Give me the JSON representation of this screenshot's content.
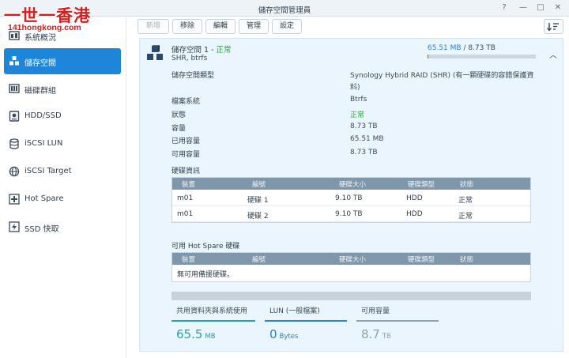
{
  "watermark": {
    "top": "一世一香港",
    "bottom": "141hongkong.com"
  },
  "window": {
    "title": "儲存空間管理員",
    "help_icon": "?",
    "minimize_icon": "—",
    "maximize_icon": "□",
    "close_icon": "✕"
  },
  "sidebar": {
    "items": [
      {
        "label": "系統概況",
        "icon": "overview-icon"
      },
      {
        "label": "儲存空間",
        "icon": "storage-cubes-icon",
        "active": true
      },
      {
        "label": "磁碟群組",
        "icon": "disk-group-icon"
      },
      {
        "label": "HDD/SSD",
        "icon": "hdd-icon"
      },
      {
        "label": "iSCSI LUN",
        "icon": "lun-icon"
      },
      {
        "label": "iSCSI Target",
        "icon": "target-icon"
      },
      {
        "label": "Hot Spare",
        "icon": "plus-icon"
      },
      {
        "label": "SSD 快取",
        "icon": "ssd-icon"
      }
    ]
  },
  "toolbar": {
    "create": "新增",
    "remove": "移除",
    "edit": "編輯",
    "manage": "管理",
    "settings": "設定",
    "sort_icon": "sort-icon"
  },
  "volume": {
    "name": "儲存空間 1",
    "separator": " - ",
    "status": "正常",
    "subtitle": "SHR, btrfs",
    "usage_used": "65.51 MB",
    "usage_sep": " / ",
    "usage_total": "8.73 TB",
    "usage_fraction": 1e-05,
    "properties": [
      {
        "label": "儲存空間類型",
        "value": "Synology Hybrid RAID (SHR) (有一顆硬碟的容錯保護資",
        "value2": "料)"
      },
      {
        "label": "檔案系統",
        "value": "Btrfs"
      },
      {
        "label": "狀態",
        "value": "正常",
        "status": true
      },
      {
        "label": "容量",
        "value": "8.73 TB"
      },
      {
        "label": "已用容量",
        "value": "65.51 MB"
      },
      {
        "label": "可用容量",
        "value": "8.73 TB"
      }
    ]
  },
  "disk_info": {
    "title": "硬碟資訊",
    "columns": [
      "裝置",
      "編號",
      "硬碟大小",
      "硬碟類型",
      "狀態"
    ],
    "rows": [
      [
        "m01",
        "硬碟 1",
        "9.10 TB",
        "HDD",
        "正常"
      ],
      [
        "m01",
        "硬碟 2",
        "9.10 TB",
        "HDD",
        "正常"
      ]
    ]
  },
  "hot_spare": {
    "title": "可用 Hot Spare 硬碟",
    "columns": [
      "裝置",
      "編號",
      "硬碟大小",
      "硬碟類型",
      "狀態"
    ],
    "empty": "無可用備援硬碟。"
  },
  "summary": [
    {
      "label": "共用資料夾與系統使用",
      "value": "65.5",
      "unit": "MB",
      "color": "#22a0a8"
    },
    {
      "label": "LUN (一般檔案)",
      "value": "0",
      "unit": "Bytes",
      "color": "#2a82c8"
    },
    {
      "label": "可用容量",
      "value": "8.7",
      "unit": "TB",
      "color": "#8fa0ae"
    }
  ]
}
